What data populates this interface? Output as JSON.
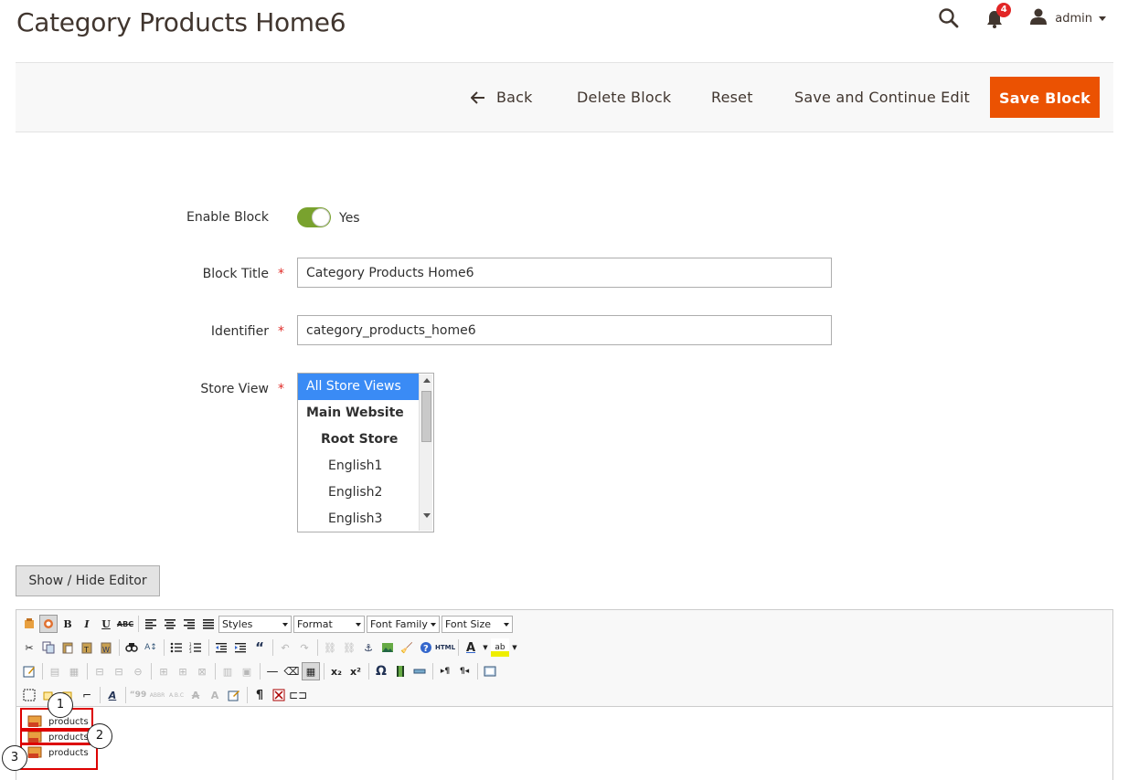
{
  "page": {
    "title": "Category Products Home6"
  },
  "header": {
    "notifications_count": "4",
    "user": "admin"
  },
  "toolbar": {
    "back": "Back",
    "delete": "Delete Block",
    "reset": "Reset",
    "save_continue": "Save and Continue Edit",
    "save": "Save Block"
  },
  "form": {
    "enable_label": "Enable Block",
    "enable_value": "Yes",
    "title_label": "Block Title",
    "title_value": "Category Products Home6",
    "identifier_label": "Identifier",
    "identifier_value": "category_products_home6",
    "store_view_label": "Store View",
    "store_options": [
      {
        "label": "All Store Views",
        "selected": true
      },
      {
        "label": "Main Website"
      },
      {
        "label": "Root Store"
      },
      {
        "label": "English1"
      },
      {
        "label": "English2"
      },
      {
        "label": "English3"
      }
    ]
  },
  "editor": {
    "show_hide": "Show / Hide Editor",
    "selects": [
      "Styles",
      "Format",
      "Font Family",
      "Font Size"
    ],
    "widgets": [
      "products",
      "products",
      "products"
    ],
    "callouts": [
      "1",
      "2",
      "3"
    ]
  },
  "colors": {
    "accent": "#eb5202",
    "toggle_on": "#79a22e",
    "selected_option": "#3a8bf5",
    "annotation": "#dd0000"
  }
}
